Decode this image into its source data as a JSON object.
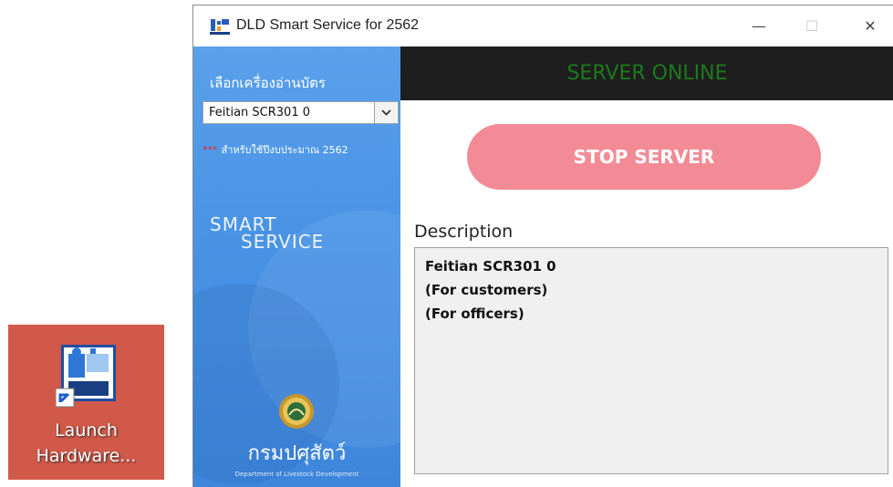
{
  "desktop_shortcut": {
    "label_line1": "Launch",
    "label_line2": "Hardware...",
    "icon": "app-shortcut-icon"
  },
  "window": {
    "title": "DLD Smart Service for 2562",
    "controls": {
      "minimize": "—",
      "maximize": "☐",
      "close": "✕"
    }
  },
  "sidebar": {
    "reader_label": "เลือกเครื่องอ่านบัตร",
    "reader_selected": "Feitian SCR301 0",
    "budget_stars": "***",
    "budget_note": "สำหรับใช้ปีงบประมาณ 2562",
    "brand_line1": "SMART",
    "brand_line2": "SERVICE",
    "department_th": "กรมปศุสัตว์",
    "department_en": "Department of Livestock Development"
  },
  "main": {
    "status": "SERVER ONLINE",
    "stop_button": "STOP SERVER",
    "description_label": "Description",
    "description_lines": [
      "Feitian SCR301 0",
      "(For customers)",
      "(For officers)"
    ]
  },
  "colors": {
    "sidebar_blue": "#4a94e6",
    "status_green": "#1d7a1d",
    "stop_button_pink": "#f28b96",
    "shortcut_bg": "#d1594a"
  }
}
